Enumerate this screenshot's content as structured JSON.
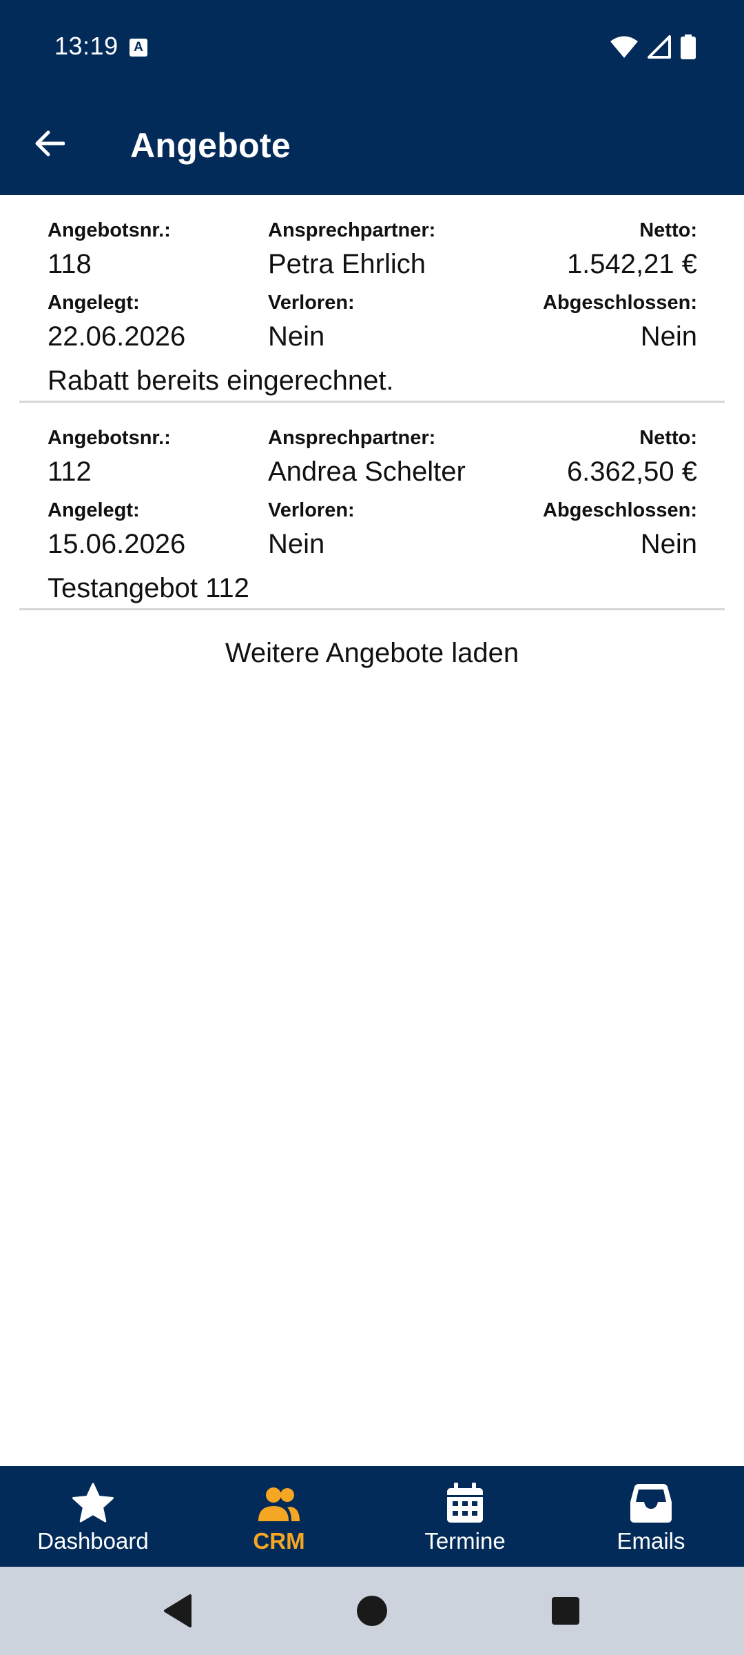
{
  "status_bar": {
    "time": "13:19",
    "notification_icon": "a-icon"
  },
  "header": {
    "title": "Angebote"
  },
  "labels": {
    "angebotsnr": "Angebotsnr.:",
    "ansprechpartner": "Ansprechpartner:",
    "netto": "Netto:",
    "angelegt": "Angelegt:",
    "verloren": "Verloren:",
    "abgeschlossen": "Abgeschlossen:"
  },
  "offers": [
    {
      "number": "118",
      "contact": "Petra Ehrlich",
      "net": "1.542,21 €",
      "created": "22.06.2026",
      "lost": "Nein",
      "closed": "Nein",
      "note": "Rabatt bereits eingerechnet."
    },
    {
      "number": "112",
      "contact": "Andrea Schelter",
      "net": "6.362,50 €",
      "created": "15.06.2026",
      "lost": "Nein",
      "closed": "Nein",
      "note": "Testangebot 112"
    }
  ],
  "load_more": "Weitere Angebote laden",
  "bottom_nav": {
    "items": [
      {
        "label": "Dashboard",
        "icon": "star-icon"
      },
      {
        "label": "CRM",
        "icon": "people-icon",
        "active": true
      },
      {
        "label": "Termine",
        "icon": "calendar-icon"
      },
      {
        "label": "Emails",
        "icon": "inbox-icon"
      }
    ]
  },
  "colors": {
    "primary": "#032b59",
    "accent": "#f5a623",
    "system_nav": "#ccd3dd"
  }
}
